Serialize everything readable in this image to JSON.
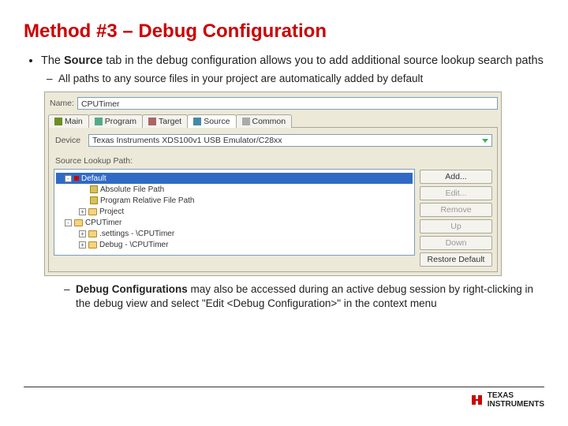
{
  "title": "Method #3 – Debug Configuration",
  "bullet1_pre": "The ",
  "bullet1_bold": "Source",
  "bullet1_post": " tab in the debug configuration allows you to add additional source lookup search paths",
  "sub1": "All paths to any source files in your project are automatically added by default",
  "sub2_bold": "Debug Configurations",
  "sub2_post": " may also be accessed during an active debug session by right-clicking in the debug view and select \"Edit <Debug Configuration>\" in the context menu",
  "dlg": {
    "name_label": "Name:",
    "name_value": "CPUTimer",
    "tabs": [
      "Main",
      "Program",
      "Target",
      "Source",
      "Common"
    ],
    "device_label": "Device",
    "device_value": "Texas Instruments XDS100v1 USB Emulator/C28xx",
    "source_label": "Source Lookup Path:",
    "tree": [
      {
        "indent": 0,
        "exp": "-",
        "icon": "cube",
        "label": "Default",
        "selected": true
      },
      {
        "indent": 1,
        "icon": "path",
        "label": "Absolute File Path"
      },
      {
        "indent": 1,
        "icon": "path",
        "label": "Program Relative File Path"
      },
      {
        "indent": 1,
        "exp": "+",
        "icon": "folder",
        "label": "Project"
      },
      {
        "indent": 0,
        "exp": "-",
        "icon": "folder",
        "label": "CPUTimer"
      },
      {
        "indent": 1,
        "exp": "+",
        "icon": "folder",
        "label": ".settings - \\CPUTimer"
      },
      {
        "indent": 1,
        "exp": "+",
        "icon": "folder",
        "label": "Debug - \\CPUTimer"
      }
    ],
    "buttons": [
      {
        "label": "Add...",
        "disabled": false
      },
      {
        "label": "Edit...",
        "disabled": true
      },
      {
        "label": "Remove",
        "disabled": true
      },
      {
        "label": "Up",
        "disabled": true
      },
      {
        "label": "Down",
        "disabled": true
      },
      {
        "label": "Restore Default",
        "disabled": false
      }
    ]
  },
  "brand_line1": "TEXAS",
  "brand_line2": "INSTRUMENTS"
}
